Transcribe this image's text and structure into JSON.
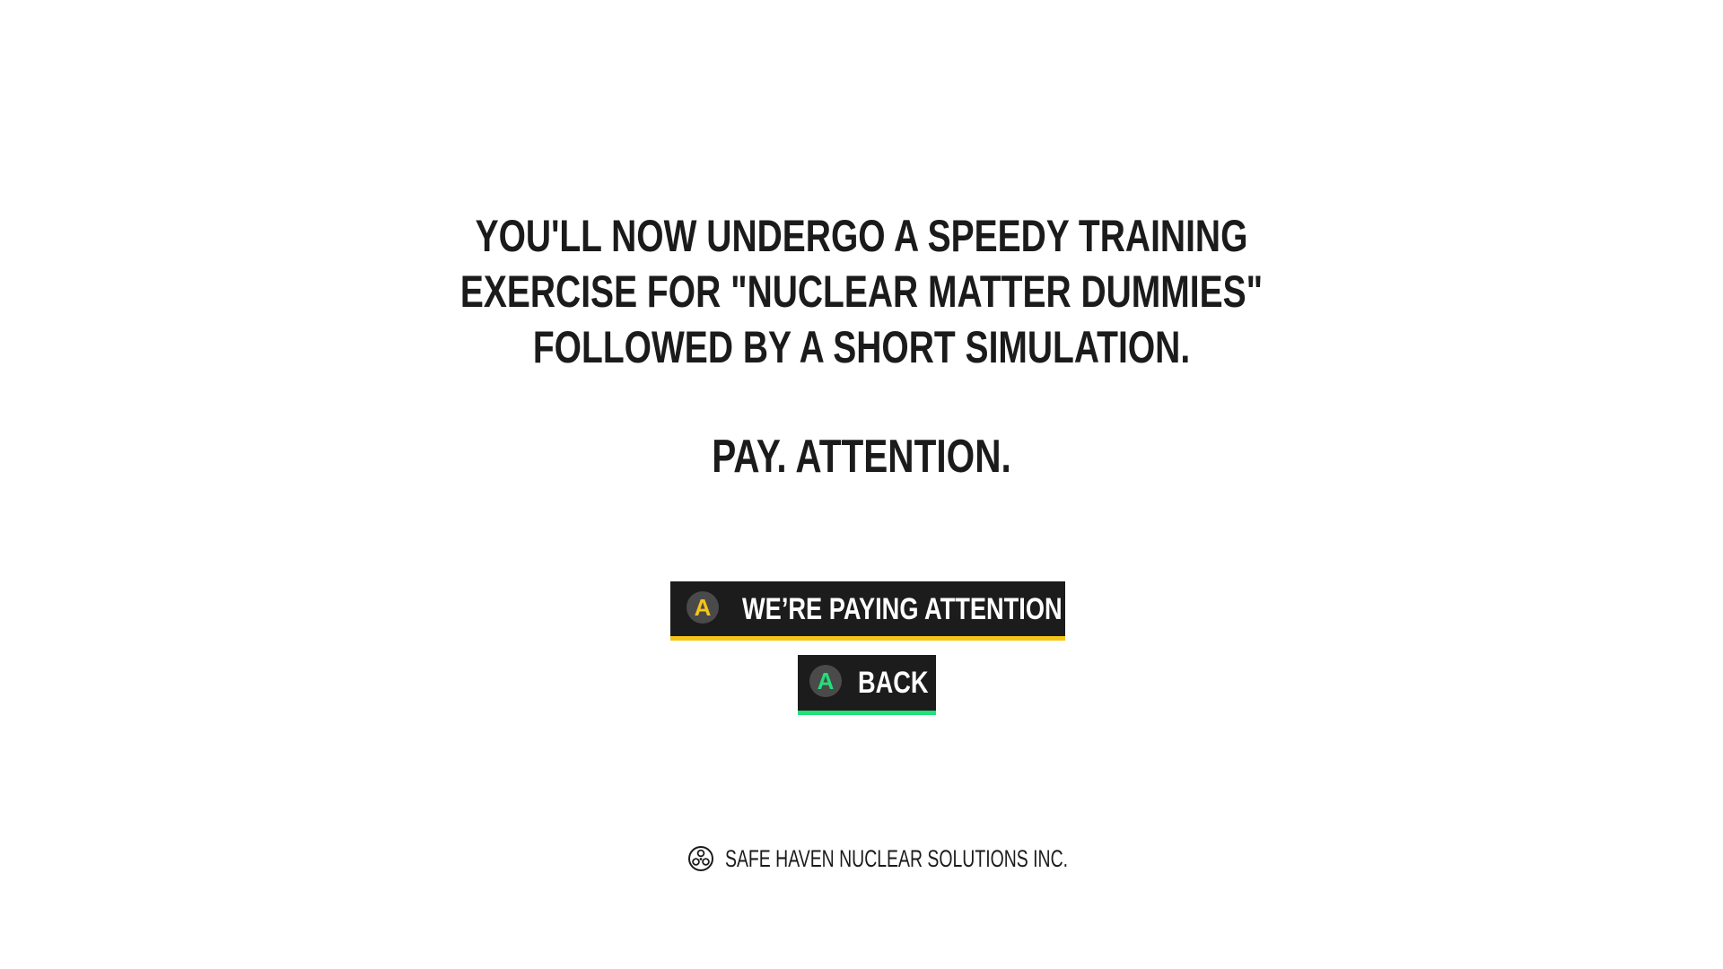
{
  "intro": {
    "lines": [
      "YOU'LL  NOW UNDERGO A SPEEDY TRAINING",
      "EXERCISE FOR \"NUCLEAR MATTER DUMMIES\"",
      "FOLLOWED BY A SHORT SIMULATION."
    ],
    "warning": "PAY. ATTENTION."
  },
  "menu": {
    "confirm": {
      "glyph": "A",
      "label": "WE’RE PAYING ATTENTION",
      "accent_color": "#f5c518"
    },
    "back": {
      "glyph": "A",
      "label": "BACK",
      "accent_color": "#22e07a"
    }
  },
  "footer": {
    "logo_icon": "atom-logo-icon",
    "company": "SAFE HAVEN NUCLEAR SOLUTIONS INC."
  },
  "colors": {
    "background": "#ffffff",
    "text": "#1b1b1b",
    "button_bg": "#1c1c1c"
  }
}
